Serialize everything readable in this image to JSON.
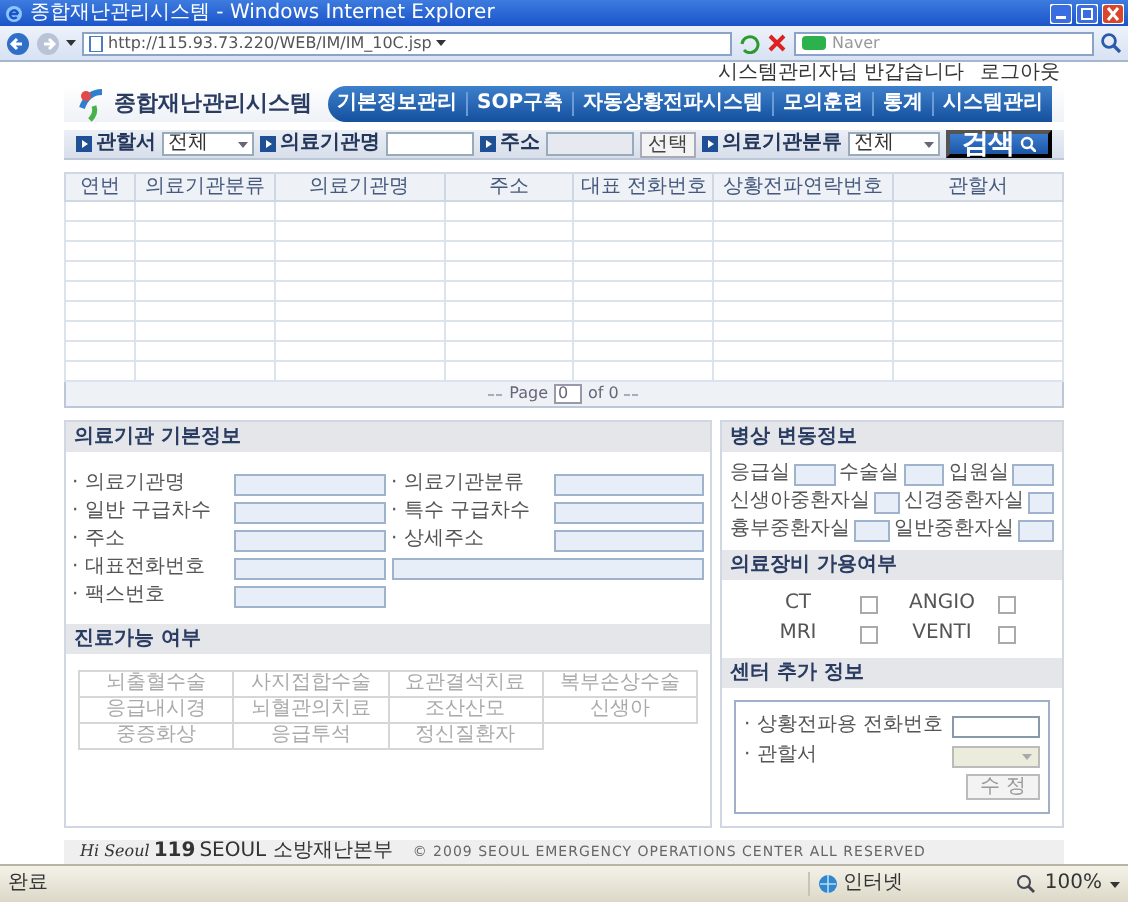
{
  "window": {
    "title": "종합재난관리시스템 - Windows Internet Explorer"
  },
  "address_bar": {
    "url": "http://115.93.73.220/WEB/IM/IM_10C.jsp"
  },
  "search_box": {
    "placeholder": "Naver"
  },
  "header": {
    "greeting": "시스템관리자님 반갑습니다",
    "logout": "로그아웃",
    "logo": "종합재난관리시스템",
    "nav": [
      "기본정보관리",
      "SOP구축",
      "자동상황전파시스템",
      "모의훈련",
      "통계",
      "시스템관리"
    ]
  },
  "filters": {
    "fields": [
      {
        "kind": "select",
        "label": "관할서",
        "value": "전체"
      },
      {
        "kind": "text",
        "label": "의료기관명"
      },
      {
        "kind": "picker",
        "label": "주소",
        "button": "선택"
      },
      {
        "kind": "select",
        "label": "의료기관분류",
        "value": "전체"
      }
    ],
    "search_button": "검색"
  },
  "table": {
    "columns": [
      "연번",
      "의료기관분류",
      "의료기관명",
      "주소",
      "대표 전화번호",
      "상황전파연락번호",
      "관할서"
    ]
  },
  "pager": {
    "label": "Page",
    "value": "0",
    "total": "of 0"
  },
  "basic_info": {
    "title": "의료기관 기본정보",
    "rows": [
      [
        {
          "kind": "field",
          "label": "· 의료기관명"
        },
        {
          "kind": "field",
          "label": "· 의료기관분류"
        }
      ],
      [
        {
          "kind": "field",
          "label": "· 일반 구급차수"
        },
        {
          "kind": "field",
          "label": "· 특수 구급차수"
        }
      ],
      [
        {
          "kind": "field",
          "label": "· 주소"
        },
        {
          "kind": "field",
          "label": "· 상세주소"
        }
      ],
      [
        {
          "kind": "field",
          "label": "· 대표전화번호"
        },
        {
          "kind": "wide"
        }
      ],
      [
        {
          "kind": "field",
          "label": "· 팩스번호"
        }
      ]
    ]
  },
  "treatment": {
    "title": "진료가능 여부",
    "items": [
      "뇌출혈수술",
      "사지접합수술",
      "요관결석치료",
      "복부손상수술",
      "응급내시경",
      "뇌혈관의치료",
      "조산산모",
      "신생아",
      "중증화상",
      "응급투석",
      "정신질환자"
    ]
  },
  "beds": {
    "title": "병상 변동정보",
    "rows": [
      [
        "응급실",
        "수술실",
        "입원실"
      ],
      [
        "신생아중환자실",
        "신경중환자실"
      ],
      [
        "흉부중환자실",
        "일반중환자실"
      ]
    ]
  },
  "equipment": {
    "title": "의료장비 가용여부",
    "items": [
      {
        "label": "CT",
        "checked": false
      },
      {
        "label": "ANGIO",
        "checked": false
      },
      {
        "label": "MRI",
        "checked": false
      },
      {
        "label": "VENTI",
        "checked": false
      }
    ]
  },
  "center": {
    "title": "센터 추가 정보",
    "phone_label": "· 상황전파용 전화번호",
    "district_label": "· 관할서",
    "district_disabled": true,
    "button": "수 정"
  },
  "footer": {
    "logo_script": "Hi Seoul",
    "logo_number": "119",
    "logo_text": "SEOUL 소방재난본부",
    "copyright": "© 2009 SEOUL EMERGENCY OPERATIONS CENTER ALL RESERVED"
  },
  "status_bar": {
    "text": "완료",
    "zone": "인터넷",
    "zoom": "100%"
  }
}
